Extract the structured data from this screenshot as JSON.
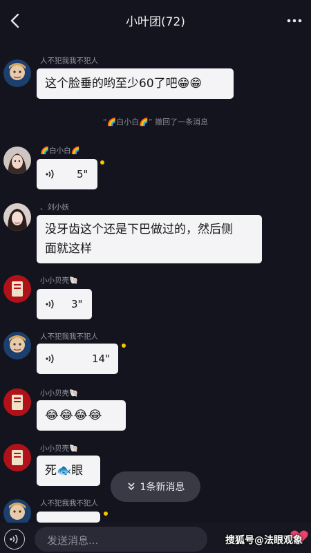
{
  "header": {
    "title": "小叶团(72)"
  },
  "system_notice": "“🌈白小白🌈” 撤回了一条消息",
  "messages": [
    {
      "sender": "人不犯我我不犯人",
      "text": "这个脸垂的哟至少60了吧😁😁"
    },
    {
      "sender": "🌈白小白🌈",
      "voice_seconds": "5\""
    },
    {
      "sender": "、刘小妖",
      "line1": "没牙齿这个还是下巴做过的，然后侧",
      "line2": "面就这样"
    },
    {
      "sender": "小小贝壳🐚",
      "voice_seconds": "3\""
    },
    {
      "sender": "人不犯我我不犯人",
      "voice_seconds": "14\""
    },
    {
      "sender": "小小贝壳🐚",
      "text": "😂😂😂😂"
    },
    {
      "sender": "小小贝壳🐚",
      "text": "死🐟眼"
    },
    {
      "sender": "人不犯我我不犯人"
    }
  ],
  "new_messages_pill": "1条新消息",
  "composer": {
    "placeholder": "发送消息..."
  },
  "watermark": "搜狐号@法眼观象",
  "colors": {
    "background": "#14141f",
    "bubble": "#f4f4f6",
    "unread_dot": "#f7c600",
    "pill": "#3a3a46"
  }
}
